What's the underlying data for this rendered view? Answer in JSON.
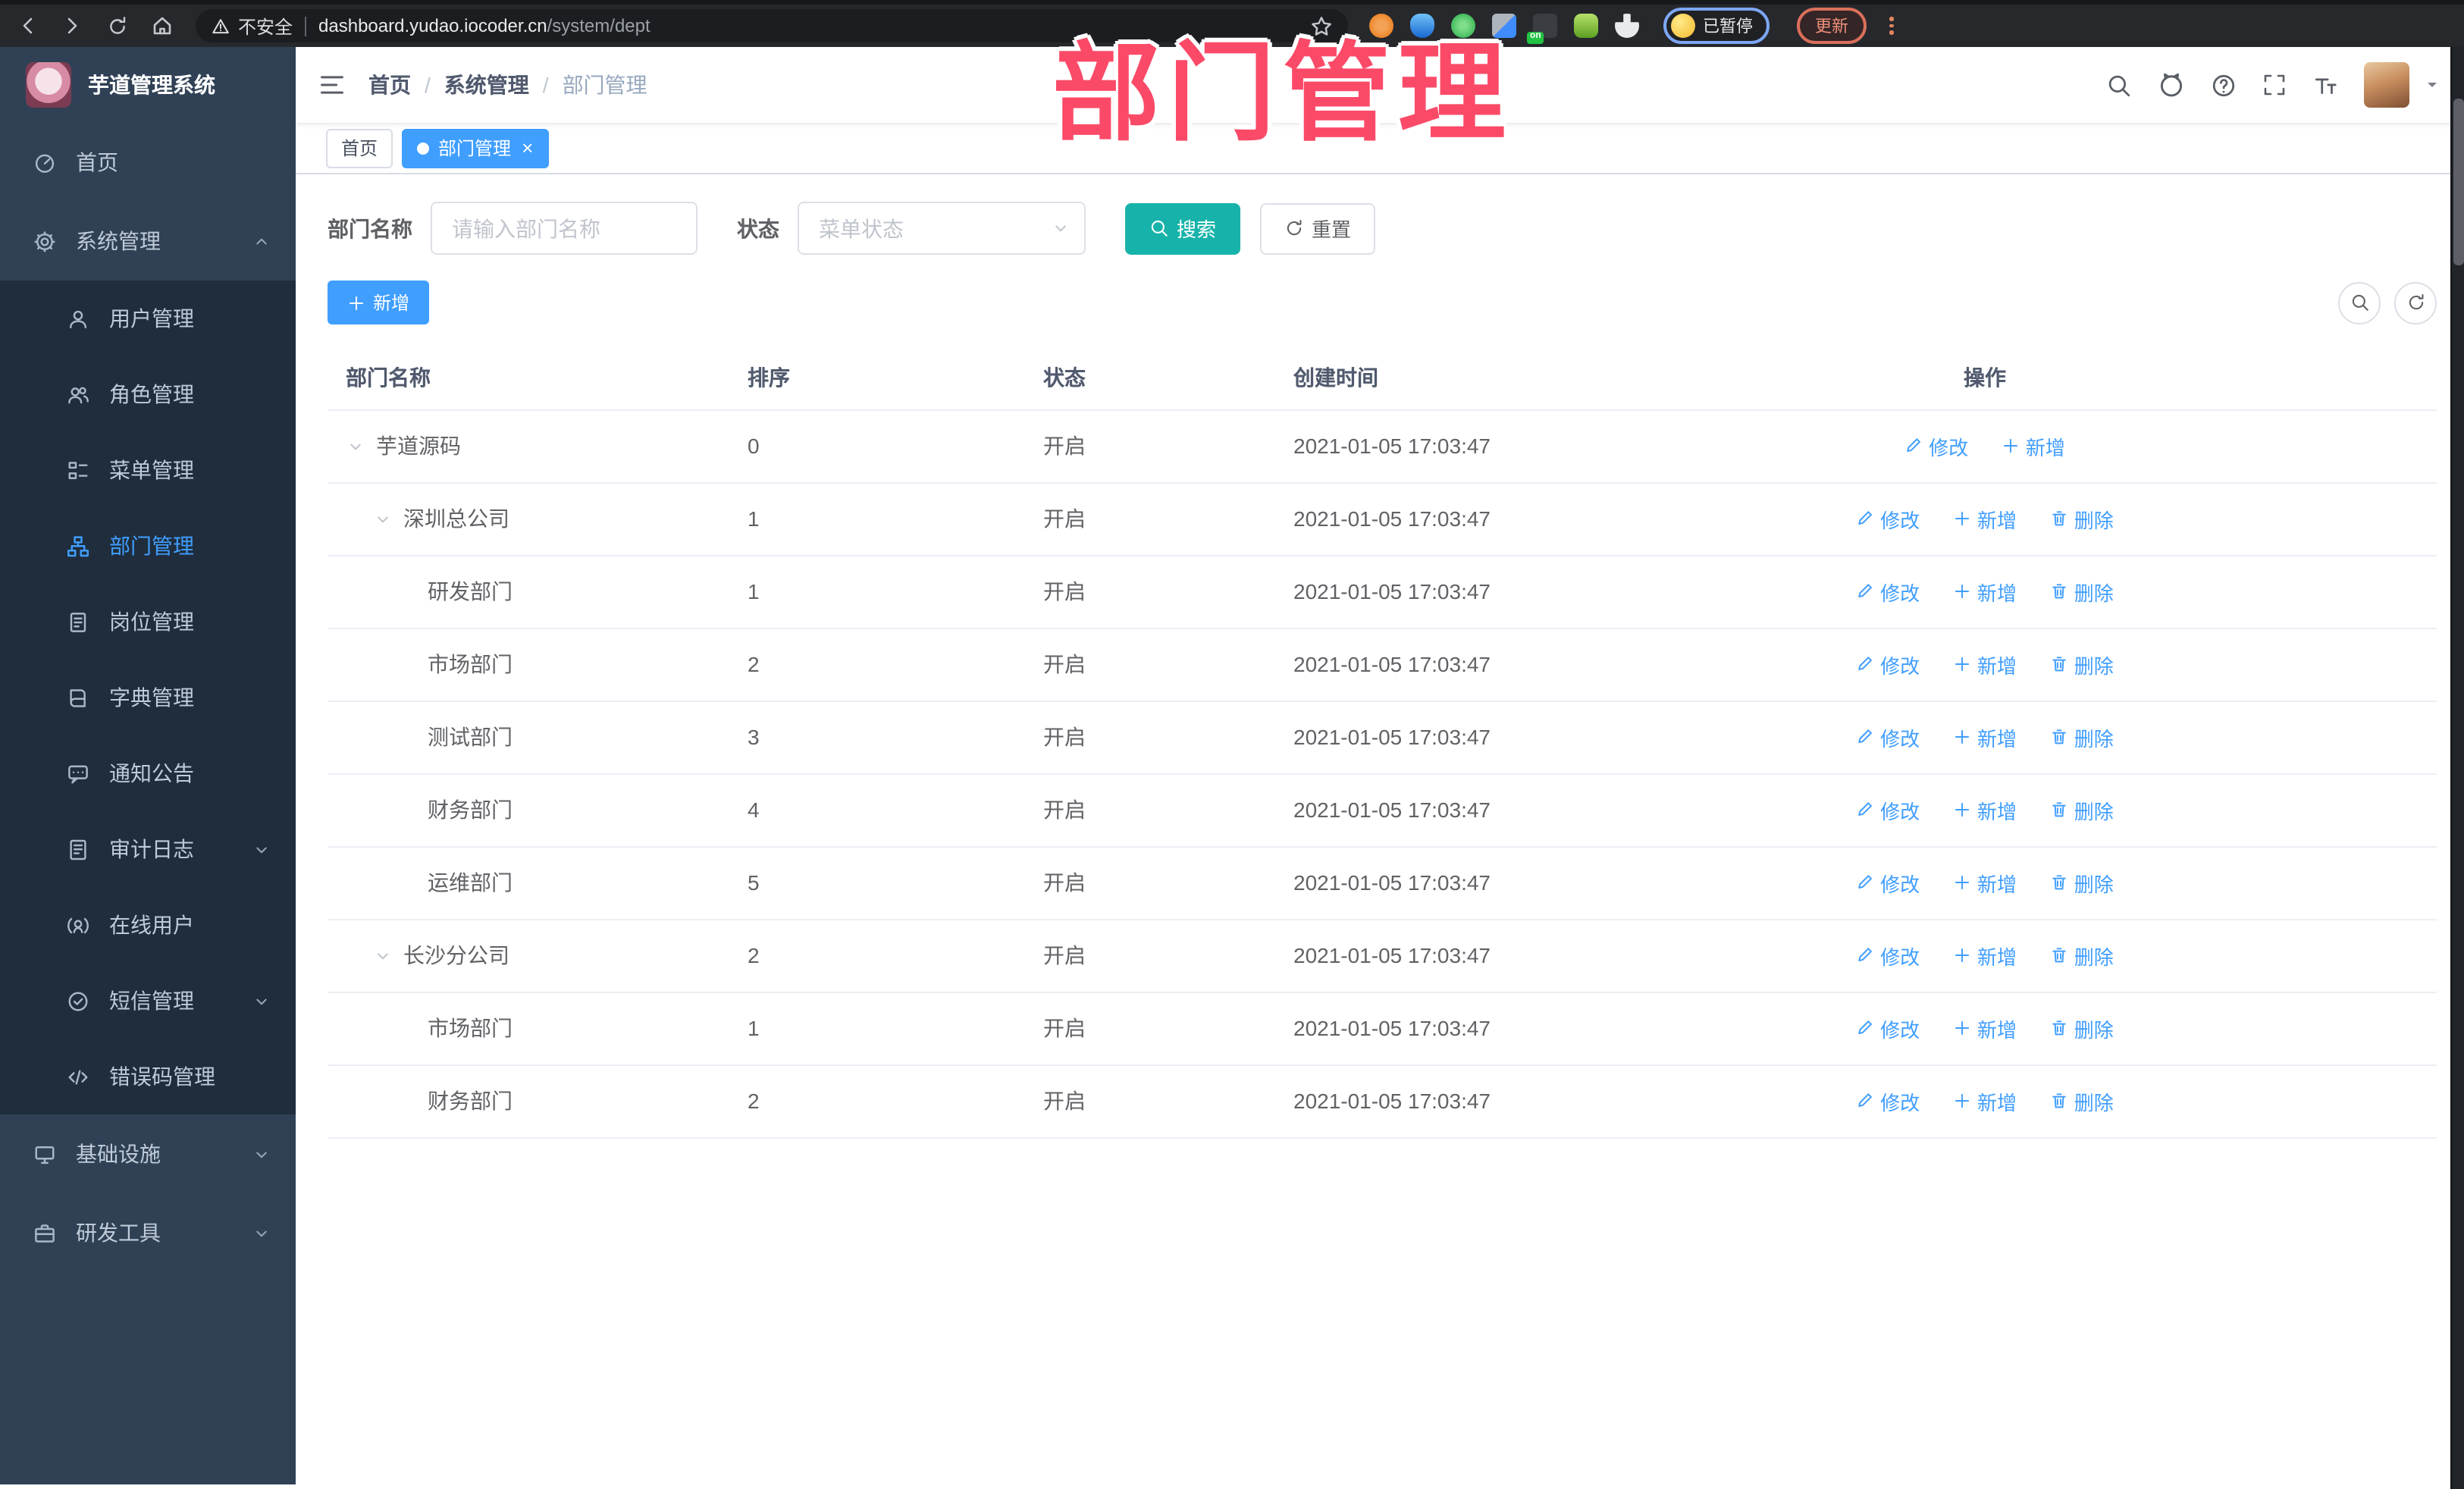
{
  "browser": {
    "security_label": "不安全",
    "url_domain": "dashboard.yudao.iocoder.cn",
    "url_path": "/system/dept",
    "extension_badge": "on",
    "profile_status": "已暂停",
    "update_label": "更新"
  },
  "overlay_title": "部门管理",
  "sidebar": {
    "title": "芋道管理系统",
    "menu": [
      {
        "label": "首页"
      },
      {
        "label": "系统管理"
      },
      {
        "label": "用户管理"
      },
      {
        "label": "角色管理"
      },
      {
        "label": "菜单管理"
      },
      {
        "label": "部门管理"
      },
      {
        "label": "岗位管理"
      },
      {
        "label": "字典管理"
      },
      {
        "label": "通知公告"
      },
      {
        "label": "审计日志"
      },
      {
        "label": "在线用户"
      },
      {
        "label": "短信管理"
      },
      {
        "label": "错误码管理"
      },
      {
        "label": "基础设施"
      },
      {
        "label": "研发工具"
      }
    ]
  },
  "breadcrumb": {
    "separator": "/",
    "items": [
      {
        "label": "首页"
      },
      {
        "label": "系统管理"
      },
      {
        "label": "部门管理"
      }
    ]
  },
  "tags": [
    {
      "label": "首页"
    },
    {
      "label": "部门管理"
    }
  ],
  "filters": {
    "dept_label": "部门名称",
    "dept_placeholder": "请输入部门名称",
    "status_label": "状态",
    "status_placeholder": "菜单状态",
    "search_label": "搜索",
    "reset_label": "重置"
  },
  "toolbar": {
    "add_label": "新增"
  },
  "table": {
    "headers": {
      "name": "部门名称",
      "sort": "排序",
      "status": "状态",
      "created": "创建时间",
      "actions": "操作"
    },
    "action_labels": {
      "edit": "修改",
      "add": "新增",
      "delete": "删除"
    },
    "rows": [
      {
        "name": "芋道源码",
        "sort": "0",
        "status": "开启",
        "created": "2021-01-05 17:03:47"
      },
      {
        "name": "深圳总公司",
        "sort": "1",
        "status": "开启",
        "created": "2021-01-05 17:03:47"
      },
      {
        "name": "研发部门",
        "sort": "1",
        "status": "开启",
        "created": "2021-01-05 17:03:47"
      },
      {
        "name": "市场部门",
        "sort": "2",
        "status": "开启",
        "created": "2021-01-05 17:03:47"
      },
      {
        "name": "测试部门",
        "sort": "3",
        "status": "开启",
        "created": "2021-01-05 17:03:47"
      },
      {
        "name": "财务部门",
        "sort": "4",
        "status": "开启",
        "created": "2021-01-05 17:03:47"
      },
      {
        "name": "运维部门",
        "sort": "5",
        "status": "开启",
        "created": "2021-01-05 17:03:47"
      },
      {
        "name": "长沙分公司",
        "sort": "2",
        "status": "开启",
        "created": "2021-01-05 17:03:47"
      },
      {
        "name": "市场部门",
        "sort": "1",
        "status": "开启",
        "created": "2021-01-05 17:03:47"
      },
      {
        "name": "财务部门",
        "sort": "2",
        "status": "开启",
        "created": "2021-01-05 17:03:47"
      }
    ]
  },
  "colors": {
    "primary": "#409eff",
    "search_button": "#17b3aa",
    "sidebar_bg": "#304156",
    "submenu_bg": "#1f2d3d",
    "overlay_pink": "#fb4a68"
  }
}
